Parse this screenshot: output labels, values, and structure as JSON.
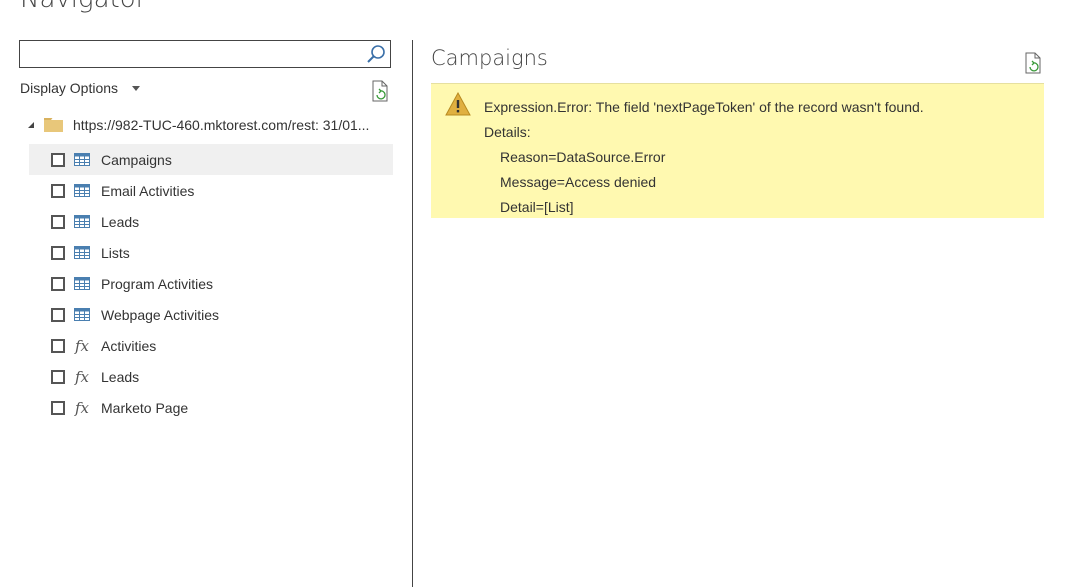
{
  "window": {
    "title": "Navigator"
  },
  "search": {
    "value": "",
    "placeholder": ""
  },
  "display_options": {
    "label": "Display Options"
  },
  "tree": {
    "root_label": "https://982-TUC-460.mktorest.com/rest: 31/01...",
    "items": [
      {
        "label": "Campaigns",
        "type": "table",
        "selected": true
      },
      {
        "label": "Email Activities",
        "type": "table",
        "selected": false
      },
      {
        "label": "Leads",
        "type": "table",
        "selected": false
      },
      {
        "label": "Lists",
        "type": "table",
        "selected": false
      },
      {
        "label": "Program Activities",
        "type": "table",
        "selected": false
      },
      {
        "label": "Webpage Activities",
        "type": "table",
        "selected": false
      },
      {
        "label": "Activities",
        "type": "function",
        "selected": false
      },
      {
        "label": "Leads",
        "type": "function",
        "selected": false
      },
      {
        "label": "Marketo Page",
        "type": "function",
        "selected": false
      }
    ]
  },
  "preview": {
    "title": "Campaigns",
    "error": {
      "headline": "Expression.Error: The field 'nextPageToken' of the record wasn't found.",
      "details_label": "Details:",
      "details": [
        "Reason=DataSource.Error",
        "Message=Access denied",
        "Detail=[List]"
      ]
    }
  },
  "icons": {
    "search": "search-icon",
    "caret": "chevron-down-icon",
    "refresh": "refresh-document-icon",
    "expander": "expand-triangle-icon",
    "folder": "folder-icon",
    "table": "table-icon",
    "function": "function-fx-icon",
    "warning": "warning-icon"
  },
  "colors": {
    "error_background": "#fff9b0",
    "selected_row": "#f0f0f0",
    "folder": "#e8c77a",
    "table_icon": "#4a7fb0",
    "refresh_accent": "#3a9a3a"
  }
}
